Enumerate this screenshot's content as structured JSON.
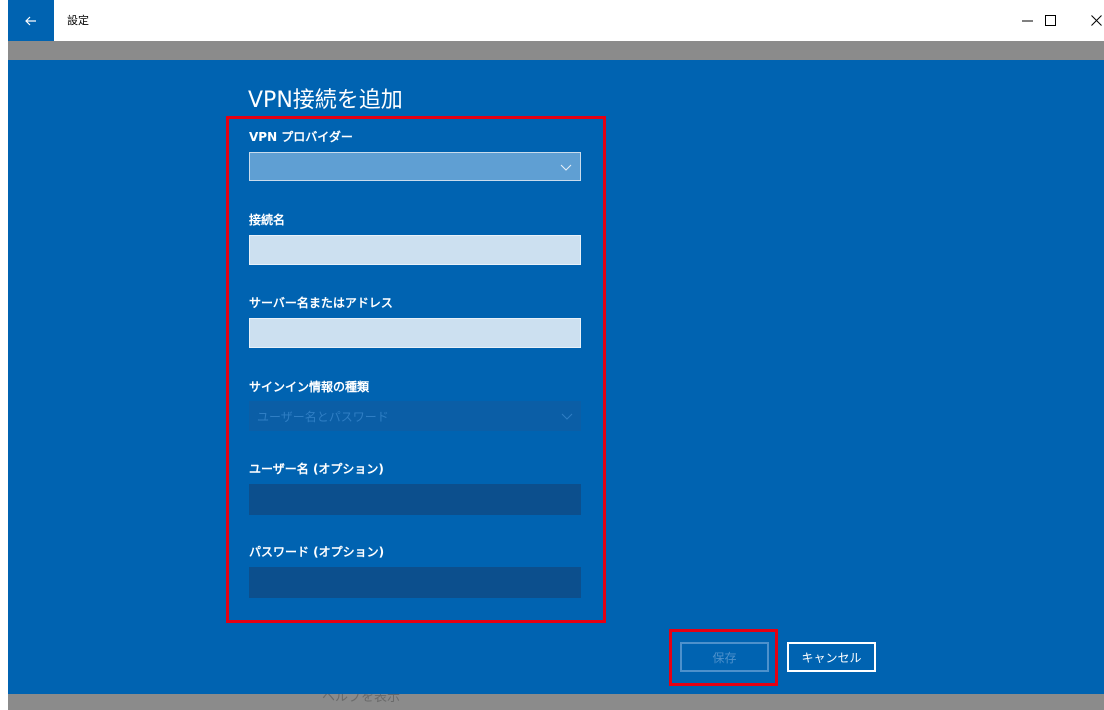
{
  "window": {
    "title": "設定",
    "back_icon": "arrow-left-icon",
    "controls": [
      "minimize-icon",
      "maximize-icon",
      "close-icon"
    ]
  },
  "page": {
    "heading": "VPN接続を追加",
    "help_link": "ヘルプを表示"
  },
  "form": {
    "vpn_provider": {
      "label": "VPN プロバイダー",
      "value": ""
    },
    "connection_name": {
      "label": "接続名",
      "value": ""
    },
    "server_address": {
      "label": "サーバー名またはアドレス",
      "value": ""
    },
    "sign_in_type": {
      "label": "サインイン情報の種類",
      "value": "ユーザー名とパスワード"
    },
    "username": {
      "label": "ユーザー名 (オプション)",
      "value": ""
    },
    "password": {
      "label": "パスワード (オプション)",
      "value": ""
    }
  },
  "actions": {
    "save_label": "保存",
    "cancel_label": "キャンセル"
  },
  "colors": {
    "background": "#0063b1",
    "highlight": "#e60012",
    "input": "#cce0f0"
  }
}
